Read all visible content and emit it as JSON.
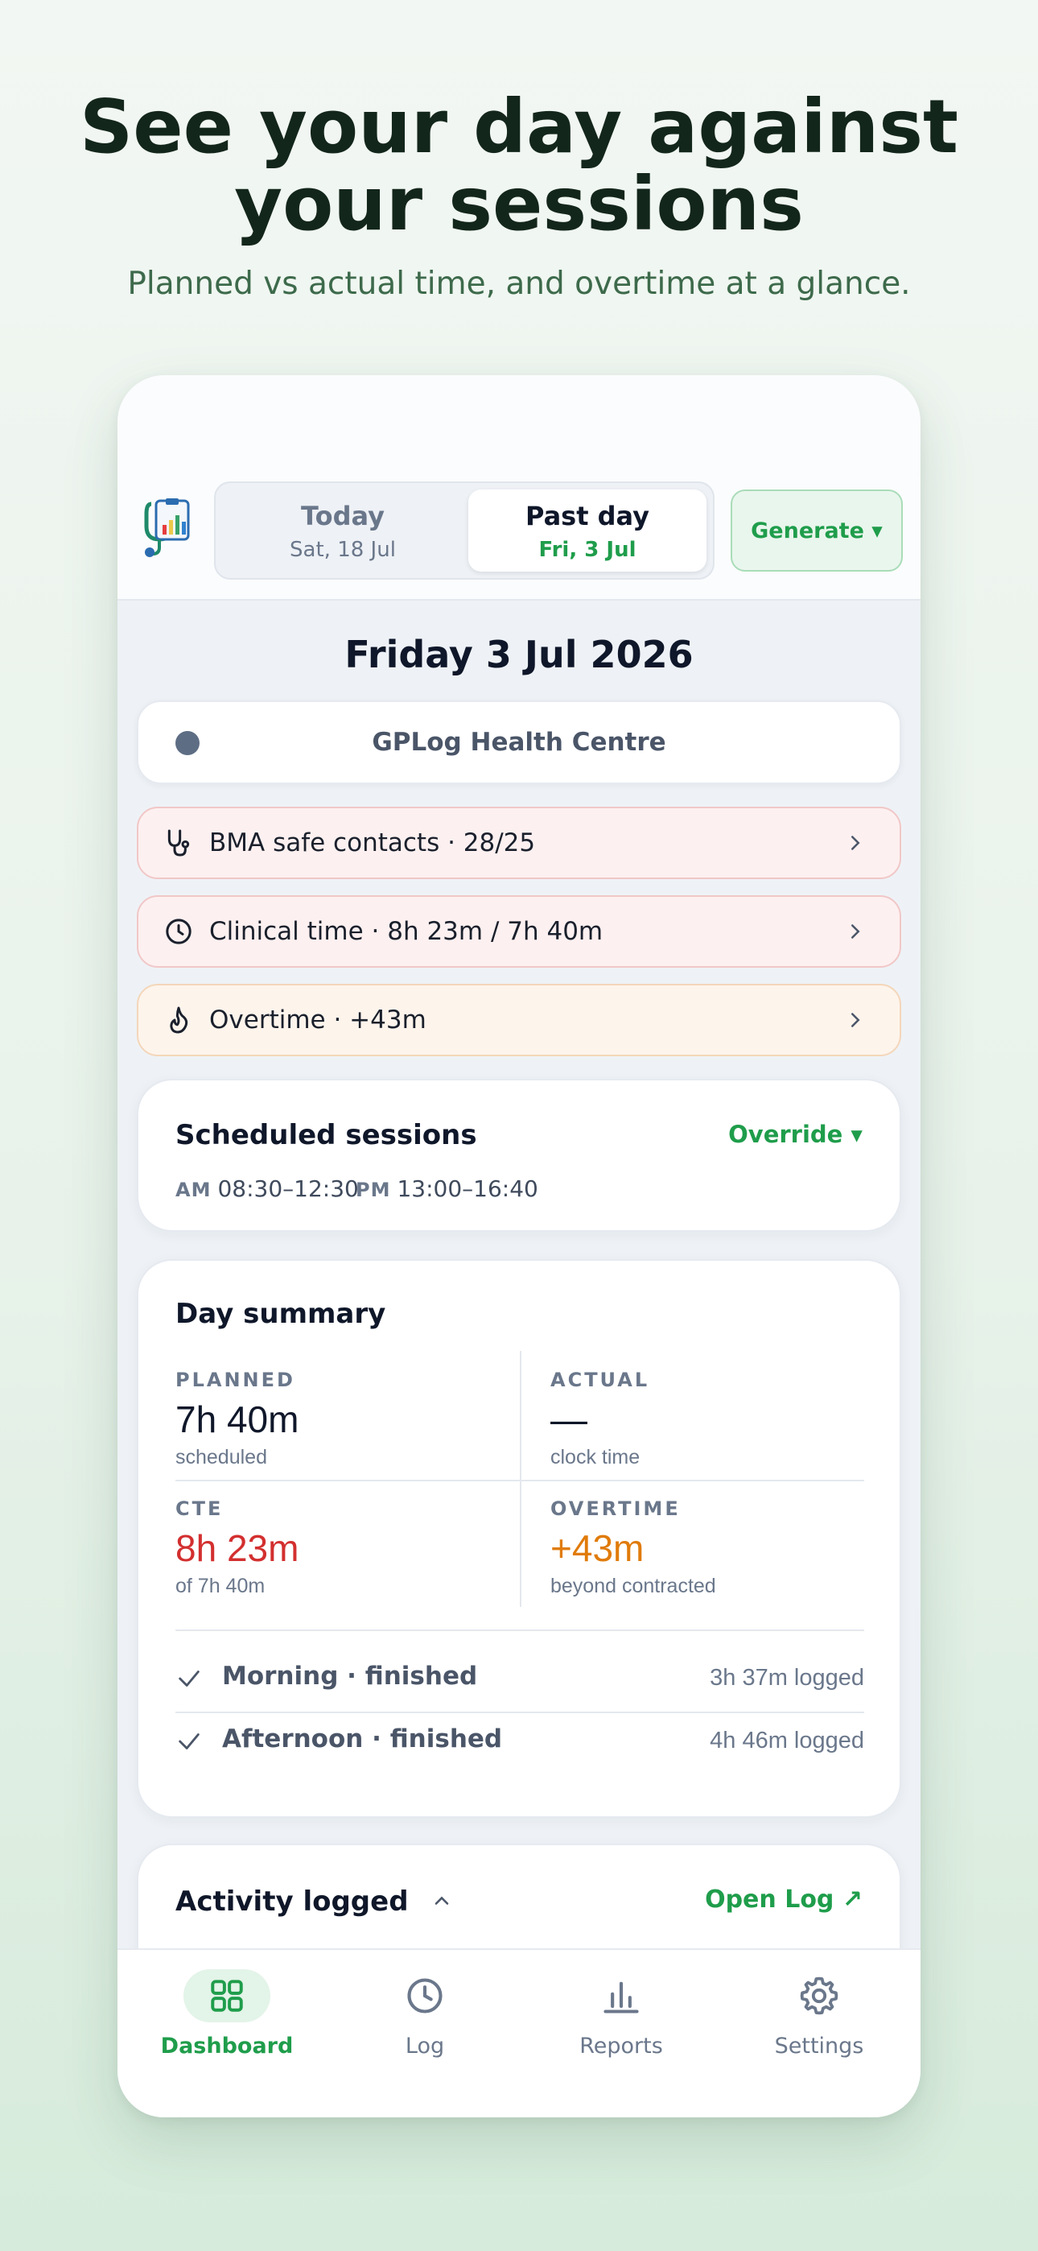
{
  "hero": {
    "headline_line1": "See your day against",
    "headline_line2": "your sessions",
    "subheadline": "Planned vs actual time, and overtime at a glance."
  },
  "header": {
    "tabs": [
      {
        "label": "Today",
        "sub": "Sat, 18 Jul",
        "selected": false
      },
      {
        "label": "Past day",
        "sub": "Fri, 3 Jul",
        "selected": true
      }
    ],
    "generate_label": "Generate ▾"
  },
  "day": {
    "title": "Friday 3 Jul 2026",
    "centre_name": "GPLog Health Centre"
  },
  "alerts": [
    {
      "icon": "stethoscope-icon",
      "text": "BMA safe contacts · 28/25",
      "tone": "red"
    },
    {
      "icon": "clock-icon",
      "text": "Clinical time · 8h 23m / 7h 40m",
      "tone": "red"
    },
    {
      "icon": "flame-icon",
      "text": "Overtime · +43m",
      "tone": "orange"
    }
  ],
  "scheduled": {
    "title": "Scheduled sessions",
    "override_label": "Override ▾",
    "am_tag": "AM",
    "am_time": "08:30–12:30",
    "pm_tag": "PM",
    "pm_time": "13:00–16:40"
  },
  "summary": {
    "title": "Day summary",
    "planned": {
      "label": "PLANNED",
      "value": "7h 40m",
      "sub": "scheduled"
    },
    "actual": {
      "label": "ACTUAL",
      "value": "—",
      "sub": "clock time"
    },
    "cte": {
      "label": "CTE",
      "value": "8h 23m",
      "sub": "of 7h 40m",
      "color": "#d32f2f"
    },
    "overtime": {
      "label": "OVERTIME",
      "value": "+43m",
      "sub": "beyond contracted",
      "color": "#e07b0a"
    },
    "sessions": [
      {
        "name": "Morning · finished",
        "logged": "3h 37m logged"
      },
      {
        "name": "Afternoon · finished",
        "logged": "4h 46m logged"
      }
    ]
  },
  "activity": {
    "title": "Activity logged",
    "open_log_label": "Open Log ↗"
  },
  "nav": [
    {
      "label": "Dashboard",
      "icon": "grid-icon",
      "active": true
    },
    {
      "label": "Log",
      "icon": "clock-icon",
      "active": false
    },
    {
      "label": "Reports",
      "icon": "bar-chart-icon",
      "active": false
    },
    {
      "label": "Settings",
      "icon": "gear-icon",
      "active": false
    }
  ],
  "colors": {
    "accent": "#1f9d4b",
    "danger": "#d32f2f",
    "warning": "#e07b0a"
  }
}
